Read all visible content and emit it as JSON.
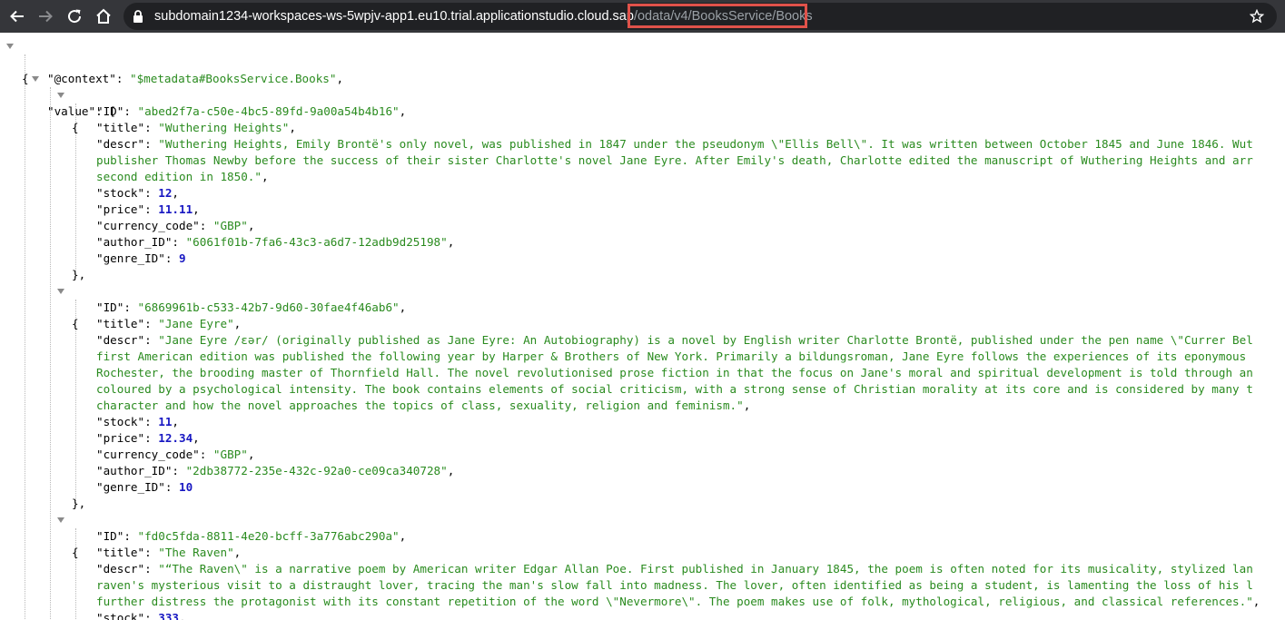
{
  "browser": {
    "url_domain": "subdomain1234-workspaces-ws-5wpjv-app1.eu10.trial.applicationstudio.cloud.sap",
    "url_path": "/odata/v4/BooksService/Books",
    "icons": [
      "back-icon",
      "forward-icon",
      "reload-icon",
      "home-icon",
      "lock-icon",
      "star-icon"
    ],
    "highlight_color": "#e0524a"
  },
  "json": {
    "context_key": "\"@context\"",
    "context_value": "\"$metadata#BooksService.Books\"",
    "value_key": "\"value\"",
    "books": [
      {
        "id": "\"abed2f7a-c50e-4bc5-89fd-9a00a54b4b16\"",
        "title": "\"Wuthering Heights\"",
        "descr_lines": [
          "\"Wuthering Heights, Emily Brontë's only novel, was published in 1847 under the pseudonym \\\"Ellis Bell\\\". It was written between October 1845 and June 1846. Wut",
          "publisher Thomas Newby before the success of their sister Charlotte's novel Jane Eyre. After Emily's death, Charlotte edited the manuscript of Wuthering Heights and arr",
          "second edition in 1850.\""
        ],
        "stock": "12",
        "price": "11.11",
        "currency_code": "\"GBP\"",
        "author_id": "\"6061f01b-7fa6-43c3-a6d7-12adb9d25198\"",
        "genre_id": "9"
      },
      {
        "id": "\"6869961b-c533-42b7-9d60-30fae4f46ab6\"",
        "title": "\"Jane Eyre\"",
        "descr_lines": [
          "\"Jane Eyre /ɛər/ (originally published as Jane Eyre: An Autobiography) is a novel by English writer Charlotte Brontë, published under the pen name \\\"Currer Bel",
          "first American edition was published the following year by Harper & Brothers of New York. Primarily a bildungsroman, Jane Eyre follows the experiences of its eponymous",
          "Rochester, the brooding master of Thornfield Hall. The novel revolutionised prose fiction in that the focus on Jane's moral and spiritual development is told through an",
          "coloured by a psychological intensity. The book contains elements of social criticism, with a strong sense of Christian morality at its core and is considered by many t",
          "character and how the novel approaches the topics of class, sexuality, religion and feminism.\""
        ],
        "stock": "11",
        "price": "12.34",
        "currency_code": "\"GBP\"",
        "author_id": "\"2db38772-235e-432c-92a0-ce09ca340728\"",
        "genre_id": "10"
      },
      {
        "id": "\"fd0c5fda-8811-4e20-bcff-3a776abc290a\"",
        "title": "\"The Raven\"",
        "descr_lines": [
          "\"“The Raven\\\" is a narrative poem by American writer Edgar Allan Poe. First published in January 1845, the poem is often noted for its musicality, stylized lan",
          "raven's mysterious visit to a distraught lover, tracing the man's slow fall into madness. The lover, often identified as being a student, is lamenting the loss of his l",
          "further distress the protagonist with its constant repetition of the word \\\"Nevermore\\\". The poem makes use of folk, mythological, religious, and classical references.\""
        ],
        "stock": "333"
      }
    ]
  },
  "labels": {
    "id": "\"ID\"",
    "title": "\"title\"",
    "descr": "\"descr\"",
    "stock": "\"stock\"",
    "price": "\"price\"",
    "currency_code": "\"currency_code\"",
    "author_id": "\"author_ID\"",
    "genre_id": "\"genre_ID\""
  },
  "colors": {
    "string": "#2a8b1f",
    "number": "#1717c2",
    "chrome": "#35363a",
    "urlbar": "#202124"
  }
}
